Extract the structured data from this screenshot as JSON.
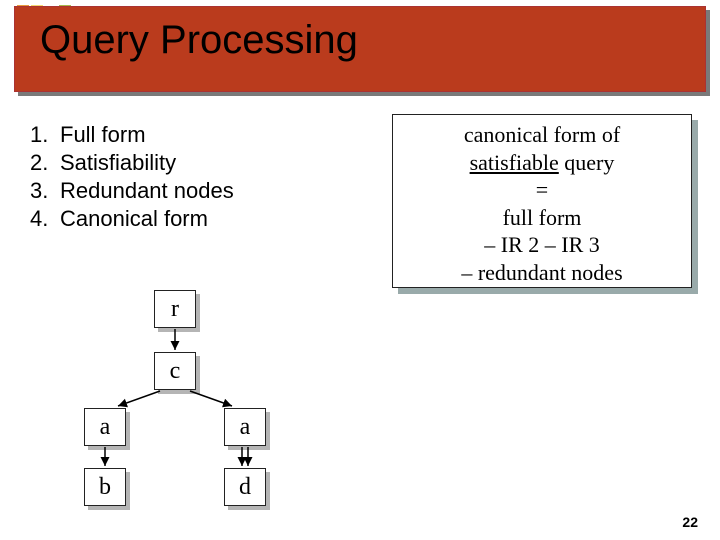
{
  "slide": {
    "title": "Query Processing",
    "page_number": "22"
  },
  "list": {
    "items": [
      {
        "num": "1.",
        "text": "Full form"
      },
      {
        "num": "2.",
        "text": "Satisfiability"
      },
      {
        "num": "3.",
        "text": "Redundant nodes"
      },
      {
        "num": "4.",
        "text": "Canonical form"
      }
    ]
  },
  "callout": {
    "line1a": "canonical form of",
    "line2_underlined": "satisfiable",
    "line2_rest": " query",
    "line3": "=",
    "line4": "full form",
    "line5": "– IR 2 – IR 3",
    "line6": "– redundant nodes"
  },
  "tree": {
    "nodes": {
      "r": "r",
      "c": "c",
      "a_left": "a",
      "a_right": "a",
      "b": "b",
      "d": "d"
    }
  }
}
